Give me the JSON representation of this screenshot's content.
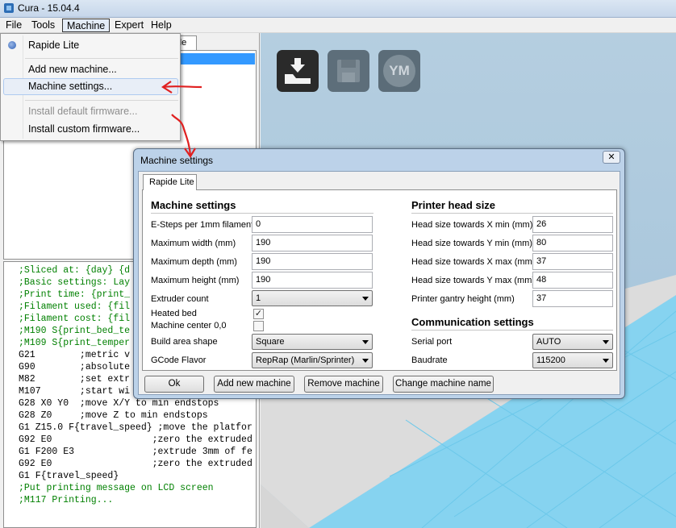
{
  "window": {
    "title": "Cura - 15.04.4"
  },
  "menubar": {
    "file": "File",
    "tools": "Tools",
    "machine": "Machine",
    "expert": "Expert",
    "help": "Help"
  },
  "left": {
    "tab_fragment": "de",
    "gcode_lines": [
      ";Sliced at: {day} {d",
      ";Basic settings: Lay",
      ";Print time: {print_",
      ";Filament used: {fil",
      ";Filament cost: {fil",
      ";M190 S{print_bed_te",
      ";M109 S{print_temper",
      "G21        ;metric v",
      "G90        ;absolute",
      "M82        ;set extr",
      "M107       ;start wi",
      "G28 X0 Y0  ;move X/Y to min endstops",
      "G28 Z0     ;move Z to min endstops",
      "G1 Z15.0 F{travel_speed} ;move the platfor",
      "G92 E0                  ;zero the extruded",
      "G1 F200 E3              ;extrude 3mm of fe",
      "G92 E0                  ;zero the extruded",
      "G1 F{travel_speed}",
      ";Put printing message on LCD screen",
      ";M117 Printing..."
    ]
  },
  "viewport": {
    "ym_label": "YM"
  },
  "machine_menu": {
    "current_machine": "Rapide Lite",
    "add_new": "Add new machine...",
    "machine_settings": "Machine settings...",
    "install_default": "Install default firmware...",
    "install_custom": "Install custom firmware..."
  },
  "dialog": {
    "title": "Machine settings",
    "close_glyph": "✕",
    "tab": "Rapide Lite",
    "machine_section": "Machine settings",
    "esteps_label": "E-Steps per 1mm filament",
    "esteps_value": "0",
    "max_width_label": "Maximum width (mm)",
    "max_width_value": "190",
    "max_depth_label": "Maximum depth (mm)",
    "max_depth_value": "190",
    "max_height_label": "Maximum height (mm)",
    "max_height_value": "190",
    "extruder_count_label": "Extruder count",
    "extruder_count_value": "1",
    "heated_bed_label": "Heated bed",
    "heated_bed_checked": true,
    "machine_center_label": "Machine center 0,0",
    "machine_center_checked": false,
    "build_area_label": "Build area shape",
    "build_area_value": "Square",
    "gcode_flavor_label": "GCode Flavor",
    "gcode_flavor_value": "RepRap (Marlin/Sprinter)",
    "head_section": "Printer head size",
    "head_xmin_label": "Head size towards X min (mm)",
    "head_xmin_value": "26",
    "head_ymin_label": "Head size towards Y min (mm)",
    "head_ymin_value": "80",
    "head_xmax_label": "Head size towards X max (mm)",
    "head_xmax_value": "37",
    "head_ymax_label": "Head size towards Y max (mm)",
    "head_ymax_value": "48",
    "gantry_label": "Printer gantry height (mm)",
    "gantry_value": "37",
    "comm_section": "Communication settings",
    "serial_label": "Serial port",
    "serial_value": "AUTO",
    "baud_label": "Baudrate",
    "baud_value": "115200",
    "ok_button": "Ok",
    "add_machine_button": "Add new machine",
    "remove_machine_button": "Remove machine",
    "change_name_button": "Change machine name"
  },
  "colors": {
    "annotation": "#e02020",
    "selection": "#3399ff",
    "gcode_comment": "#008000",
    "viewport_sky": "#a9c7dc",
    "bed_blue": "#7fd7f2"
  }
}
